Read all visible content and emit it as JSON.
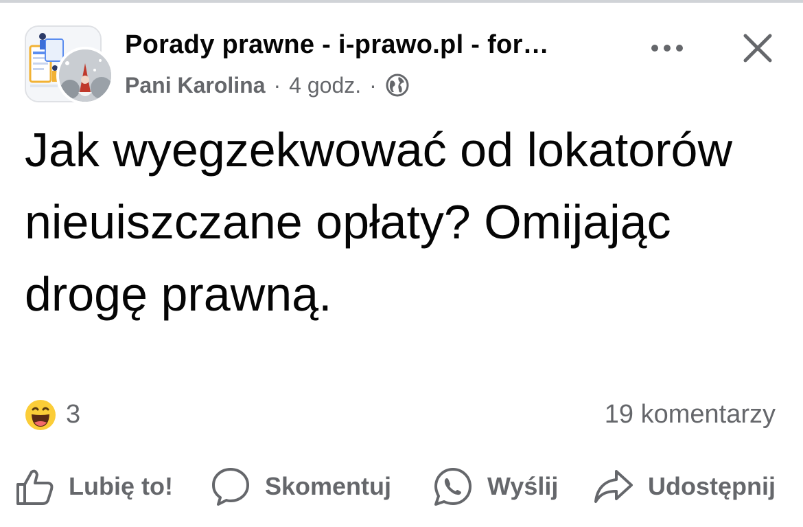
{
  "post": {
    "group_name": "Porady prawne - i-prawo.pl - for…",
    "author": "Pani Karolina",
    "separator": "·",
    "time": "4 godz.",
    "text": "Jak wyegzekwować od lokatorów nieuiszczane opłaty? Omijając drogę prawną.",
    "reaction_count": "3",
    "comments": "19 komentarzy",
    "privacy_icon": "globe-icon",
    "reaction_icon": "haha-emoji-icon"
  },
  "actions": {
    "like": "Lubię to!",
    "comment": "Skomentuj",
    "send": "Wyślij",
    "share": "Udostępnij"
  },
  "colors": {
    "text_primary": "#050505",
    "text_secondary": "#65676b",
    "reaction_yellow": "#fbcd38"
  }
}
